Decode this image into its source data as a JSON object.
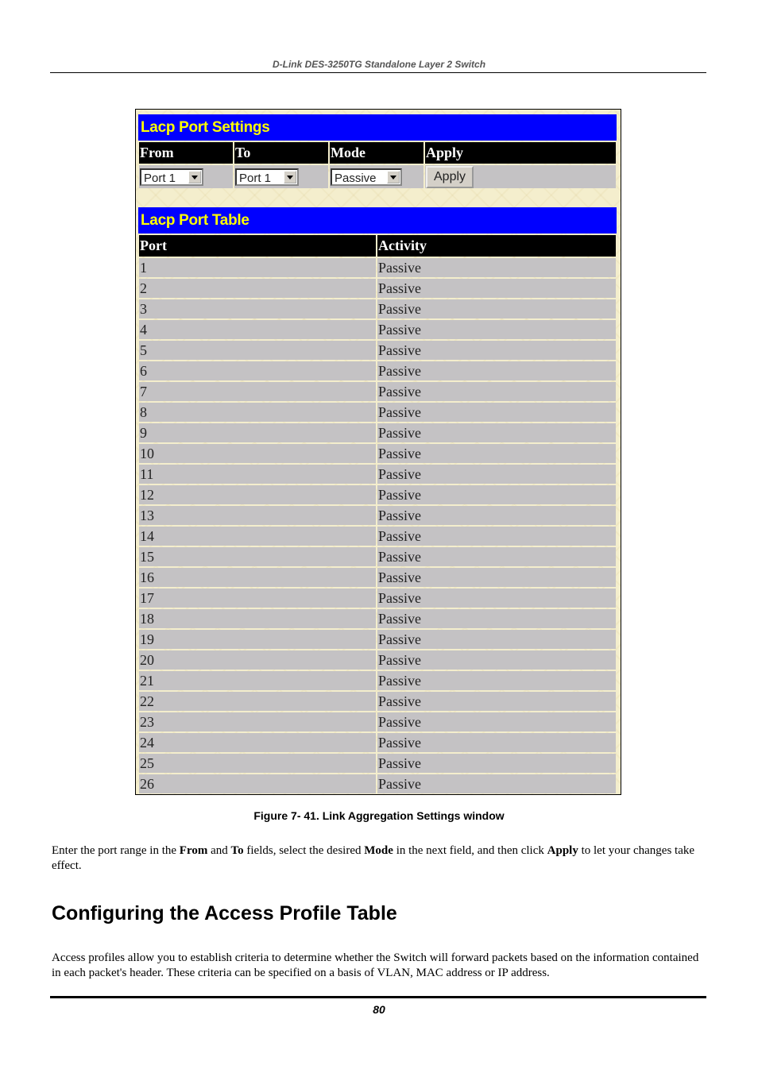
{
  "header": {
    "running_title": "D-Link DES-3250TG Standalone Layer 2 Switch"
  },
  "figure": {
    "settings": {
      "title": "Lacp Port Settings",
      "columns": [
        "From",
        "To",
        "Mode",
        "Apply"
      ],
      "from_value": "Port 1",
      "to_value": "Port 1",
      "mode_value": "Passive",
      "apply_label": "Apply"
    },
    "port_table": {
      "title": "Lacp Port Table",
      "columns": [
        "Port",
        "Activity"
      ],
      "rows": [
        {
          "port": "1",
          "activity": "Passive"
        },
        {
          "port": "2",
          "activity": "Passive"
        },
        {
          "port": "3",
          "activity": "Passive"
        },
        {
          "port": "4",
          "activity": "Passive"
        },
        {
          "port": "5",
          "activity": "Passive"
        },
        {
          "port": "6",
          "activity": "Passive"
        },
        {
          "port": "7",
          "activity": "Passive"
        },
        {
          "port": "8",
          "activity": "Passive"
        },
        {
          "port": "9",
          "activity": "Passive"
        },
        {
          "port": "10",
          "activity": "Passive"
        },
        {
          "port": "11",
          "activity": "Passive"
        },
        {
          "port": "12",
          "activity": "Passive"
        },
        {
          "port": "13",
          "activity": "Passive"
        },
        {
          "port": "14",
          "activity": "Passive"
        },
        {
          "port": "15",
          "activity": "Passive"
        },
        {
          "port": "16",
          "activity": "Passive"
        },
        {
          "port": "17",
          "activity": "Passive"
        },
        {
          "port": "18",
          "activity": "Passive"
        },
        {
          "port": "19",
          "activity": "Passive"
        },
        {
          "port": "20",
          "activity": "Passive"
        },
        {
          "port": "21",
          "activity": "Passive"
        },
        {
          "port": "22",
          "activity": "Passive"
        },
        {
          "port": "23",
          "activity": "Passive"
        },
        {
          "port": "24",
          "activity": "Passive"
        },
        {
          "port": "25",
          "activity": "Passive"
        },
        {
          "port": "26",
          "activity": "Passive"
        }
      ]
    },
    "caption": "Figure 7- 41.  Link Aggregation Settings window"
  },
  "body": {
    "instruction_parts": [
      {
        "text": "Enter the port range in the ",
        "bold": false
      },
      {
        "text": "From",
        "bold": true
      },
      {
        "text": " and ",
        "bold": false
      },
      {
        "text": "To",
        "bold": true
      },
      {
        "text": " fields, select the desired ",
        "bold": false
      },
      {
        "text": "Mode",
        "bold": true
      },
      {
        "text": " in the next field, and then click ",
        "bold": false
      },
      {
        "text": "Apply",
        "bold": true
      },
      {
        "text": " to let your changes take effect.",
        "bold": false
      }
    ],
    "section_heading": "Configuring the Access Profile Table",
    "section_paragraph": "Access profiles allow you to establish criteria to determine whether the Switch will forward packets based on the information contained in each packet's header. These criteria can be specified on a basis of VLAN, MAC address or IP address."
  },
  "footer": {
    "page_number": "80"
  }
}
